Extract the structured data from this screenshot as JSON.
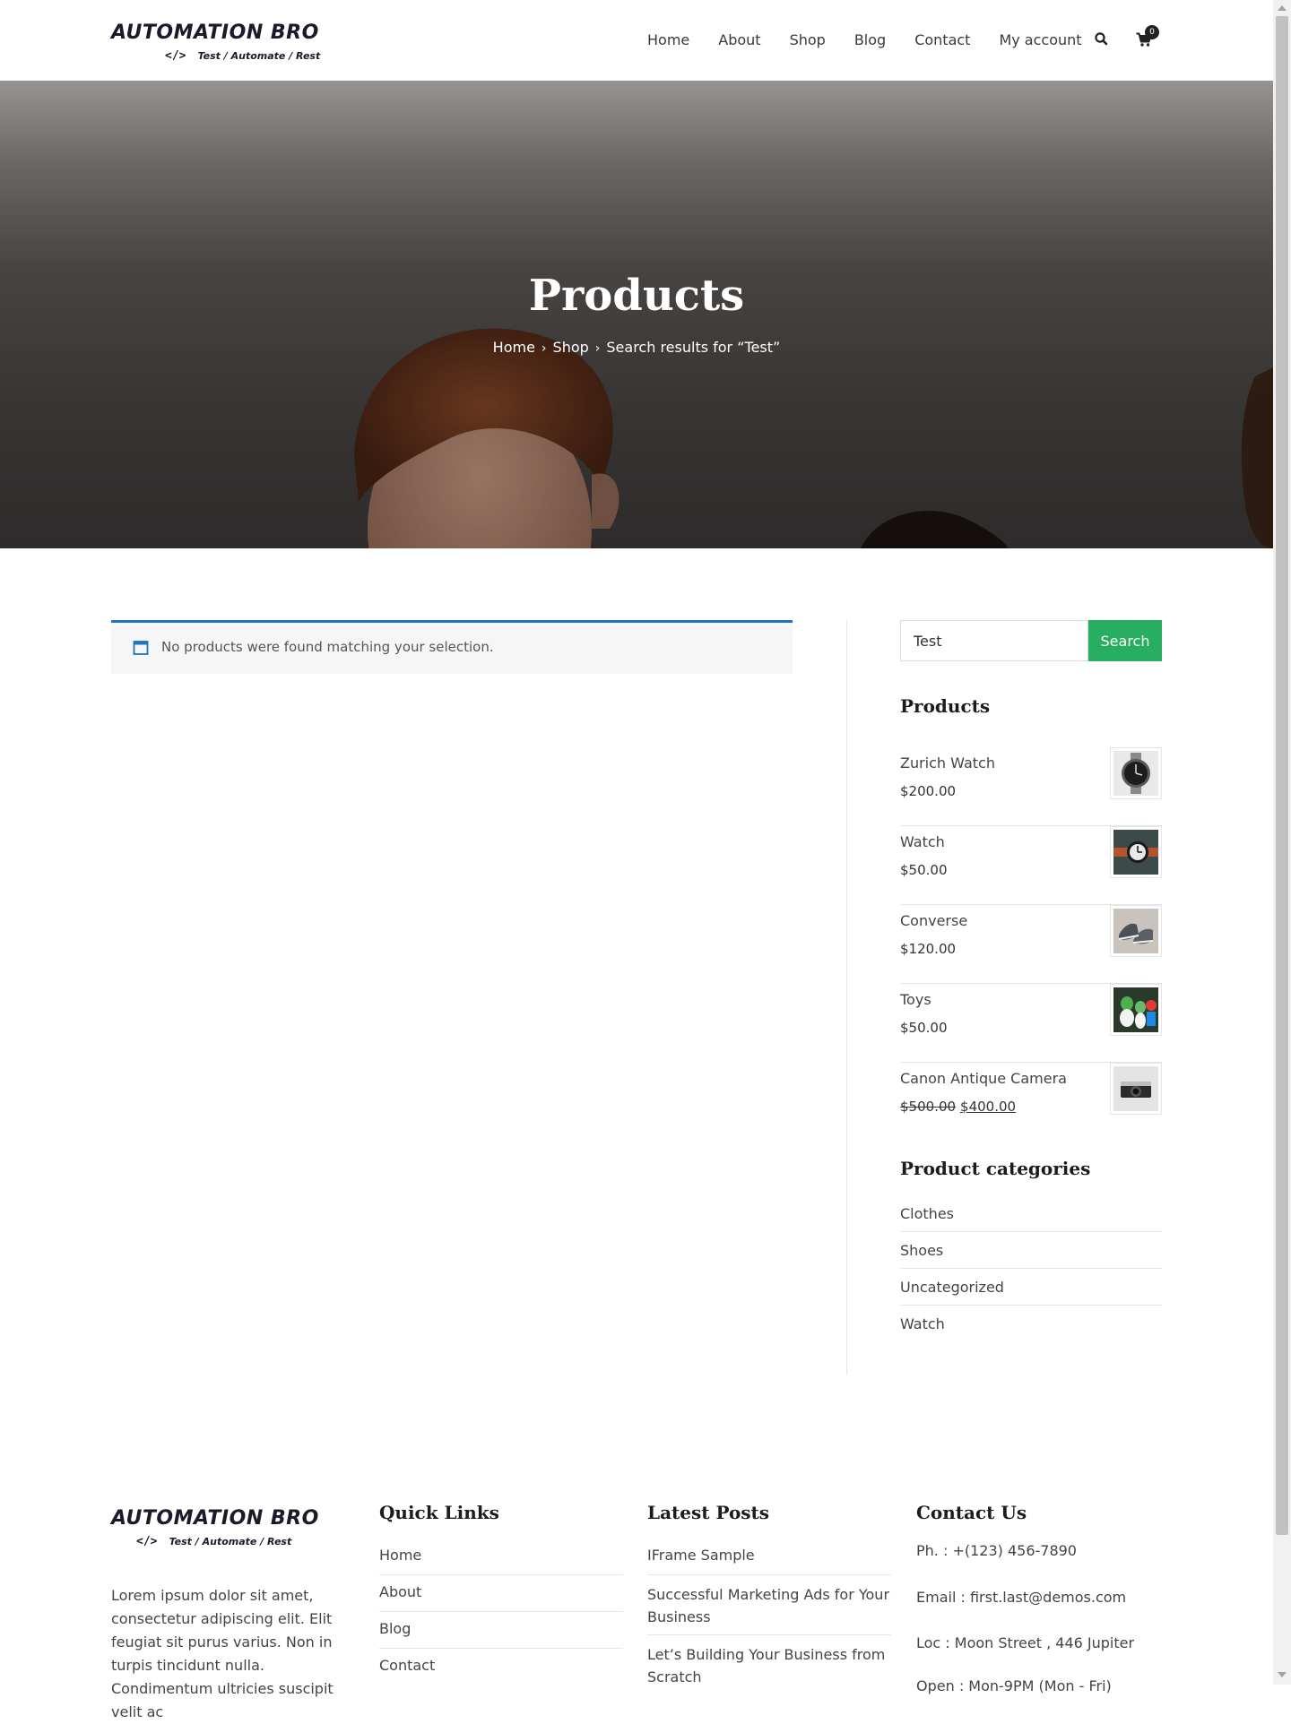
{
  "header": {
    "logo_main": "AUTOMATION BRO",
    "logo_code": "</>",
    "logo_tagline": "Test / Automate / Rest",
    "nav": [
      "Home",
      "About",
      "Shop",
      "Blog",
      "Contact",
      "My account"
    ],
    "cart_count": "0",
    "icons": [
      "search-icon",
      "cart-icon"
    ]
  },
  "hero": {
    "title": "Products",
    "breadcrumb": [
      "Home",
      "Shop",
      "Search results for “Test”"
    ],
    "separator": "›"
  },
  "main": {
    "notice": "No products were found matching your selection.",
    "notice_icon": "info-window-icon",
    "accent_color": "#1e73be"
  },
  "sidebar": {
    "search": {
      "value": "Test",
      "button_label": "Search",
      "button_color": "#27ae60"
    },
    "products_title": "Products",
    "products": [
      {
        "name": "Zurich Watch",
        "price": "$200.00",
        "thumb": "watch-image"
      },
      {
        "name": "Watch",
        "price": "$50.00",
        "thumb": "watch-image"
      },
      {
        "name": "Converse",
        "price": "$120.00",
        "thumb": "sneakers-image"
      },
      {
        "name": "Toys",
        "price": "$50.00",
        "thumb": "toys-image"
      },
      {
        "name": "Canon Antique Camera",
        "price_old": "$500.00",
        "price": "$400.00",
        "thumb": "camera-image"
      }
    ],
    "categories_title": "Product categories",
    "categories": [
      "Clothes",
      "Shoes",
      "Uncategorized",
      "Watch"
    ]
  },
  "footer": {
    "logo_main": "AUTOMATION BRO",
    "logo_code": "</>",
    "logo_tagline": "Test / Automate / Rest",
    "about_text": "Lorem ipsum dolor sit amet, consectetur adipiscing elit. Elit feugiat sit purus varius. Non in turpis tincidunt nulla. Condimentum ultricies suscipit velit ac",
    "quick_links_title": "Quick Links",
    "quick_links": [
      "Home",
      "About",
      "Blog",
      "Contact"
    ],
    "latest_posts_title": "Latest Posts",
    "latest_posts": [
      "IFrame Sample",
      "Successful Marketing Ads for Your Business",
      "Let’s Building Your Business from Scratch"
    ],
    "contact_title": "Contact Us",
    "contact": {
      "phone": "Ph. : +(123) 456-7890",
      "email": "Email : first.last@demos.com",
      "location": "Loc : Moon Street , 446 Jupiter",
      "hours": "Open : Mon-9PM (Mon - Fri)"
    }
  }
}
